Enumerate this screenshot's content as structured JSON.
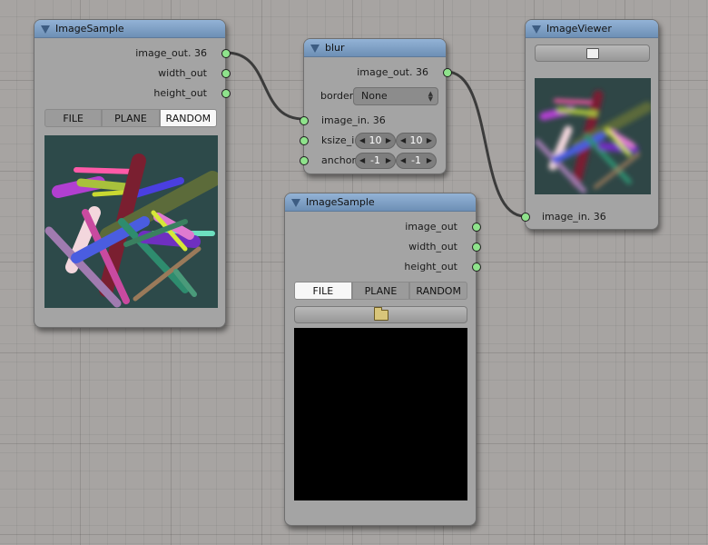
{
  "colors": {
    "header": "#7f9fc4",
    "socket": "#8fe38c",
    "node_body": "#a4a4a4",
    "canvas": "#a7a4a2"
  },
  "node1": {
    "title": "ImageSample",
    "outputs": [
      "image_out. 36",
      "width_out",
      "height_out"
    ],
    "tabs": [
      "FILE",
      "PLANE",
      "RANDOM"
    ],
    "active_tab": "RANDOM"
  },
  "node_blur": {
    "title": "blur",
    "output": "image_out. 36",
    "border_label": "border",
    "border_value": "None",
    "input": "image_in. 36",
    "ksize_label": "ksize_i",
    "ksize_values": [
      "10",
      "10"
    ],
    "anchor_label": "anchor",
    "anchor_values": [
      "-1",
      "-1"
    ]
  },
  "node_viewer": {
    "title": "ImageViewer",
    "input": "image_in. 36",
    "button_icon": "image-view-icon"
  },
  "node2": {
    "title": "ImageSample",
    "outputs": [
      "image_out",
      "width_out",
      "height_out"
    ],
    "tabs": [
      "FILE",
      "PLANE",
      "RANDOM"
    ],
    "active_tab": "FILE",
    "button_icon": "folder-icon"
  }
}
